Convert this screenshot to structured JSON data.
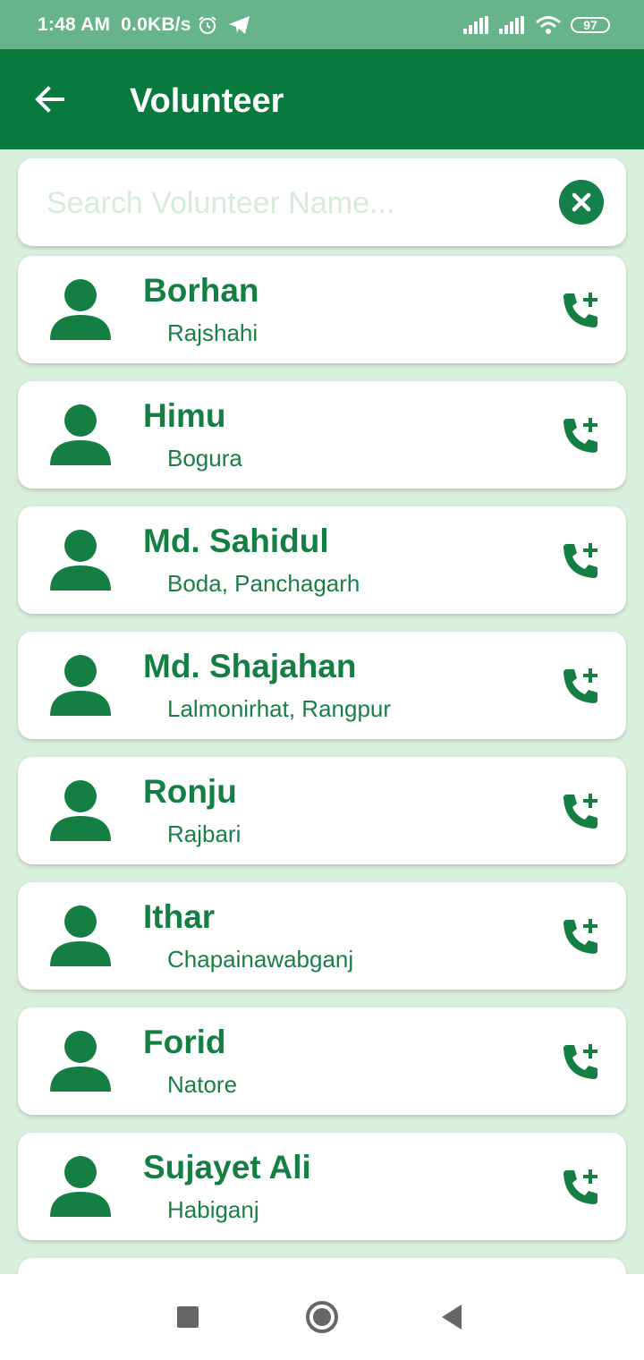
{
  "status_bar": {
    "time": "1:48 AM",
    "net_speed": "0.0KB/s",
    "battery": "97",
    "icons": [
      "alarm-icon",
      "telegram-icon",
      "signal-icon",
      "signal-icon",
      "wifi-icon",
      "battery-icon"
    ]
  },
  "app_bar": {
    "title": "Volunteer",
    "back_icon": "arrow-back-icon"
  },
  "search": {
    "placeholder": "Search Volunteer Name...",
    "value": "",
    "clear_icon": "close-circle-icon"
  },
  "volunteers": [
    {
      "name": "Borhan",
      "location": "Rajshahi"
    },
    {
      "name": "Himu",
      "location": "Bogura"
    },
    {
      "name": "Md. Sahidul",
      "location": "Boda, Panchagarh"
    },
    {
      "name": "Md. Shajahan",
      "location": "Lalmonirhat, Rangpur"
    },
    {
      "name": "Ronju",
      "location": "Rajbari"
    },
    {
      "name": "Ithar",
      "location": "Chapainawabganj"
    },
    {
      "name": "Forid",
      "location": "Natore"
    },
    {
      "name": "Sujayet Ali",
      "location": "Habiganj"
    },
    {
      "name": "",
      "location": ""
    }
  ],
  "colors": {
    "primary": "#087a3e",
    "status_bar": "#67b38a",
    "accent": "#157f43",
    "background": "#d9efdd"
  },
  "nav_bar": {
    "icons": [
      "recents-square-icon",
      "home-circle-icon",
      "back-triangle-icon"
    ]
  }
}
